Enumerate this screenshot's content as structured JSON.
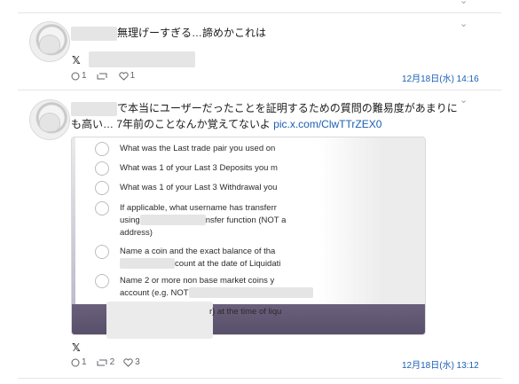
{
  "post1": {
    "text": "無理げーすぎる…諦めかこれは",
    "platform_icon": "x-logo-icon",
    "reply_count": "1",
    "retweet_count": "",
    "like_count": "1",
    "date": "12月18日(水) 14:16"
  },
  "post2": {
    "text_line1": "で本当にユーザーだったことを証明するための質問の難易度があまりに",
    "text_line2": "も高い… 7年前のことなんか覚えてないよ",
    "link": "pic.x.com/ClwTTrZEX0",
    "platform_icon": "x-logo-icon",
    "reply_count": "1",
    "retweet_count": "2",
    "like_count": "3",
    "date": "12月18日(水) 13:12"
  },
  "card": {
    "questions": [
      {
        "line1": "What was the Last trade pair you used on"
      },
      {
        "line1": "What was 1 of your Last 3 Deposits you m"
      },
      {
        "line1": "What was 1 of your Last 3 Withdrawal you"
      },
      {
        "line1": "If applicable, what username has transferr",
        "line2_pre": "using",
        "line2_post": "nsfer function (NOT a",
        "line3": "address)"
      },
      {
        "line1": "Name a coin and the exact balance of tha",
        "line2_post": "count at the date of Liquidati"
      },
      {
        "line1": "Name 2 or more non base market coins y",
        "line2_pre": "account (e.g. NOT",
        "line3_post": "r) at the time of liqu"
      }
    ]
  },
  "colors": {
    "link": "#1a5fb4",
    "date": "#1a5fb4",
    "muted": "#5f6368"
  }
}
